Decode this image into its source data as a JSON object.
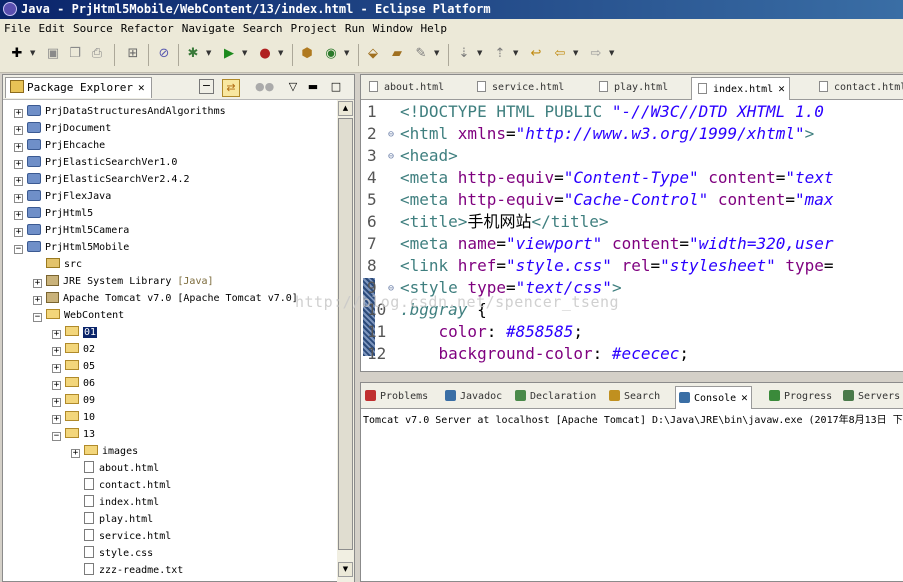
{
  "window": {
    "title": "Java - PrjHtml5Mobile/WebContent/13/index.html - Eclipse Platform"
  },
  "menu": [
    "File",
    "Edit",
    "Source",
    "Refactor",
    "Navigate",
    "Search",
    "Project",
    "Run",
    "Window",
    "Help"
  ],
  "explorer": {
    "tab_label": "Package Explorer",
    "items": [
      {
        "label": "PrjDataStructuresAndAlgorithms",
        "type": "project",
        "toggle": "+"
      },
      {
        "label": "PrjDocument",
        "type": "project",
        "toggle": "+"
      },
      {
        "label": "PrjEhcache",
        "type": "project",
        "toggle": "+"
      },
      {
        "label": "PrjElasticSearchVer1.0",
        "type": "project",
        "toggle": "+"
      },
      {
        "label": "PrjElasticSearchVer2.4.2",
        "type": "project",
        "toggle": "+"
      },
      {
        "label": "PrjFlexJava",
        "type": "project",
        "toggle": "+"
      },
      {
        "label": "PrjHtml5",
        "type": "project",
        "toggle": "+"
      },
      {
        "label": "PrjHtml5Camera",
        "type": "project",
        "toggle": "+"
      },
      {
        "label": "PrjHtml5Mobile",
        "type": "project",
        "toggle": "-"
      },
      {
        "label": "src",
        "type": "src",
        "toggle": ""
      },
      {
        "label": "JRE System Library",
        "suffix": "[Java]",
        "type": "library",
        "toggle": "+"
      },
      {
        "label": "Apache Tomcat v7.0 [Apache Tomcat v7.0]",
        "type": "library",
        "toggle": "+"
      },
      {
        "label": "WebContent",
        "type": "folder",
        "toggle": "-"
      },
      {
        "label": "01",
        "type": "folder",
        "toggle": "+",
        "selected": true
      },
      {
        "label": "02",
        "type": "folder",
        "toggle": "+"
      },
      {
        "label": "05",
        "type": "folder",
        "toggle": "+"
      },
      {
        "label": "06",
        "type": "folder",
        "toggle": "+"
      },
      {
        "label": "09",
        "type": "folder",
        "toggle": "+"
      },
      {
        "label": "10",
        "type": "folder",
        "toggle": "+"
      },
      {
        "label": "13",
        "type": "folder",
        "toggle": "-"
      },
      {
        "label": "images",
        "type": "folder",
        "toggle": "+"
      },
      {
        "label": "about.html",
        "type": "file",
        "toggle": ""
      },
      {
        "label": "contact.html",
        "type": "file",
        "toggle": ""
      },
      {
        "label": "index.html",
        "type": "file",
        "toggle": ""
      },
      {
        "label": "play.html",
        "type": "file",
        "toggle": ""
      },
      {
        "label": "service.html",
        "type": "file",
        "toggle": ""
      },
      {
        "label": "style.css",
        "type": "file",
        "toggle": ""
      },
      {
        "label": "zzz-readme.txt",
        "type": "file",
        "toggle": ""
      }
    ]
  },
  "editor": {
    "tabs": [
      "about.html",
      "service.html",
      "play.html",
      "index.html",
      "contact.html"
    ],
    "active_tab": "index.html",
    "lines": [
      {
        "n": "1",
        "fold": "",
        "tokens": [
          [
            "t-tag",
            "<!DOCTYPE HTML PUBLIC "
          ],
          [
            "t-str",
            "\"-//W3C//DTD XHTML 1.0"
          ]
        ]
      },
      {
        "n": "2",
        "fold": "⊖",
        "tokens": [
          [
            "t-tag",
            "<html "
          ],
          [
            "t-attr",
            "xmlns"
          ],
          [
            "t-text",
            "="
          ],
          [
            "t-str",
            "\"http://www.w3.org/1999/xhtml\""
          ],
          [
            "t-tag",
            ">"
          ]
        ]
      },
      {
        "n": "3",
        "fold": "⊖",
        "tokens": [
          [
            "t-tag",
            "<head>"
          ]
        ]
      },
      {
        "n": "4",
        "fold": "",
        "tokens": [
          [
            "t-tag",
            "<meta "
          ],
          [
            "t-attr",
            "http-equiv"
          ],
          [
            "t-text",
            "="
          ],
          [
            "t-str",
            "\"Content-Type\""
          ],
          [
            "t-text",
            " "
          ],
          [
            "t-attr",
            "content"
          ],
          [
            "t-text",
            "="
          ],
          [
            "t-str",
            "\"text"
          ]
        ]
      },
      {
        "n": "5",
        "fold": "",
        "tokens": [
          [
            "t-tag",
            "<meta "
          ],
          [
            "t-attr",
            "http-equiv"
          ],
          [
            "t-text",
            "="
          ],
          [
            "t-str",
            "\"Cache-Control\""
          ],
          [
            "t-text",
            " "
          ],
          [
            "t-attr",
            "content"
          ],
          [
            "t-text",
            "="
          ],
          [
            "t-str",
            "\"max"
          ]
        ]
      },
      {
        "n": "6",
        "fold": "",
        "tokens": [
          [
            "t-tag",
            "<title>"
          ],
          [
            "t-text",
            "手机网站"
          ],
          [
            "t-tag",
            "</title>"
          ]
        ]
      },
      {
        "n": "7",
        "fold": "",
        "tokens": [
          [
            "t-tag",
            "<meta "
          ],
          [
            "t-attr",
            "name"
          ],
          [
            "t-text",
            "="
          ],
          [
            "t-str",
            "\"viewport\""
          ],
          [
            "t-text",
            " "
          ],
          [
            "t-attr",
            "content"
          ],
          [
            "t-text",
            "="
          ],
          [
            "t-str",
            "\"width=320,user"
          ]
        ]
      },
      {
        "n": "8",
        "fold": "",
        "tokens": [
          [
            "t-tag",
            "<link "
          ],
          [
            "t-attr",
            "href"
          ],
          [
            "t-text",
            "="
          ],
          [
            "t-str",
            "\"style.css\""
          ],
          [
            "t-text",
            " "
          ],
          [
            "t-attr",
            "rel"
          ],
          [
            "t-text",
            "="
          ],
          [
            "t-str",
            "\"stylesheet\""
          ],
          [
            "t-text",
            " "
          ],
          [
            "t-attr",
            "type"
          ],
          [
            "t-text",
            "="
          ]
        ]
      },
      {
        "n": "9",
        "fold": "⊖",
        "tokens": [
          [
            "t-tag",
            "<style "
          ],
          [
            "t-attr",
            "type"
          ],
          [
            "t-text",
            "="
          ],
          [
            "t-str",
            "\"text/css\""
          ],
          [
            "t-tag",
            ">"
          ]
        ]
      },
      {
        "n": "10",
        "fold": "",
        "tokens": [
          [
            "t-sel",
            ".bggray"
          ],
          [
            "t-text",
            " {"
          ]
        ]
      },
      {
        "n": "11",
        "fold": "",
        "tokens": [
          [
            "t-text",
            "    "
          ],
          [
            "t-prop",
            "color"
          ],
          [
            "t-text",
            ": "
          ],
          [
            "t-val",
            "#858585"
          ],
          [
            "t-text",
            ";"
          ]
        ]
      },
      {
        "n": "12",
        "fold": "",
        "tokens": [
          [
            "t-text",
            "    "
          ],
          [
            "t-prop",
            "background-color"
          ],
          [
            "t-text",
            ": "
          ],
          [
            "t-val",
            "#ececec"
          ],
          [
            "t-text",
            ";"
          ]
        ]
      }
    ],
    "watermark": "http://blog.csdn.net/spencer_tseng"
  },
  "console": {
    "tabs": [
      "Problems",
      "Javadoc",
      "Declaration",
      "Search",
      "Console",
      "Progress",
      "Servers"
    ],
    "active_tab": "Console",
    "line": "Tomcat v7.0 Server at localhost [Apache Tomcat] D:\\Java\\JRE\\bin\\javaw.exe (2017年8月13日 下"
  }
}
